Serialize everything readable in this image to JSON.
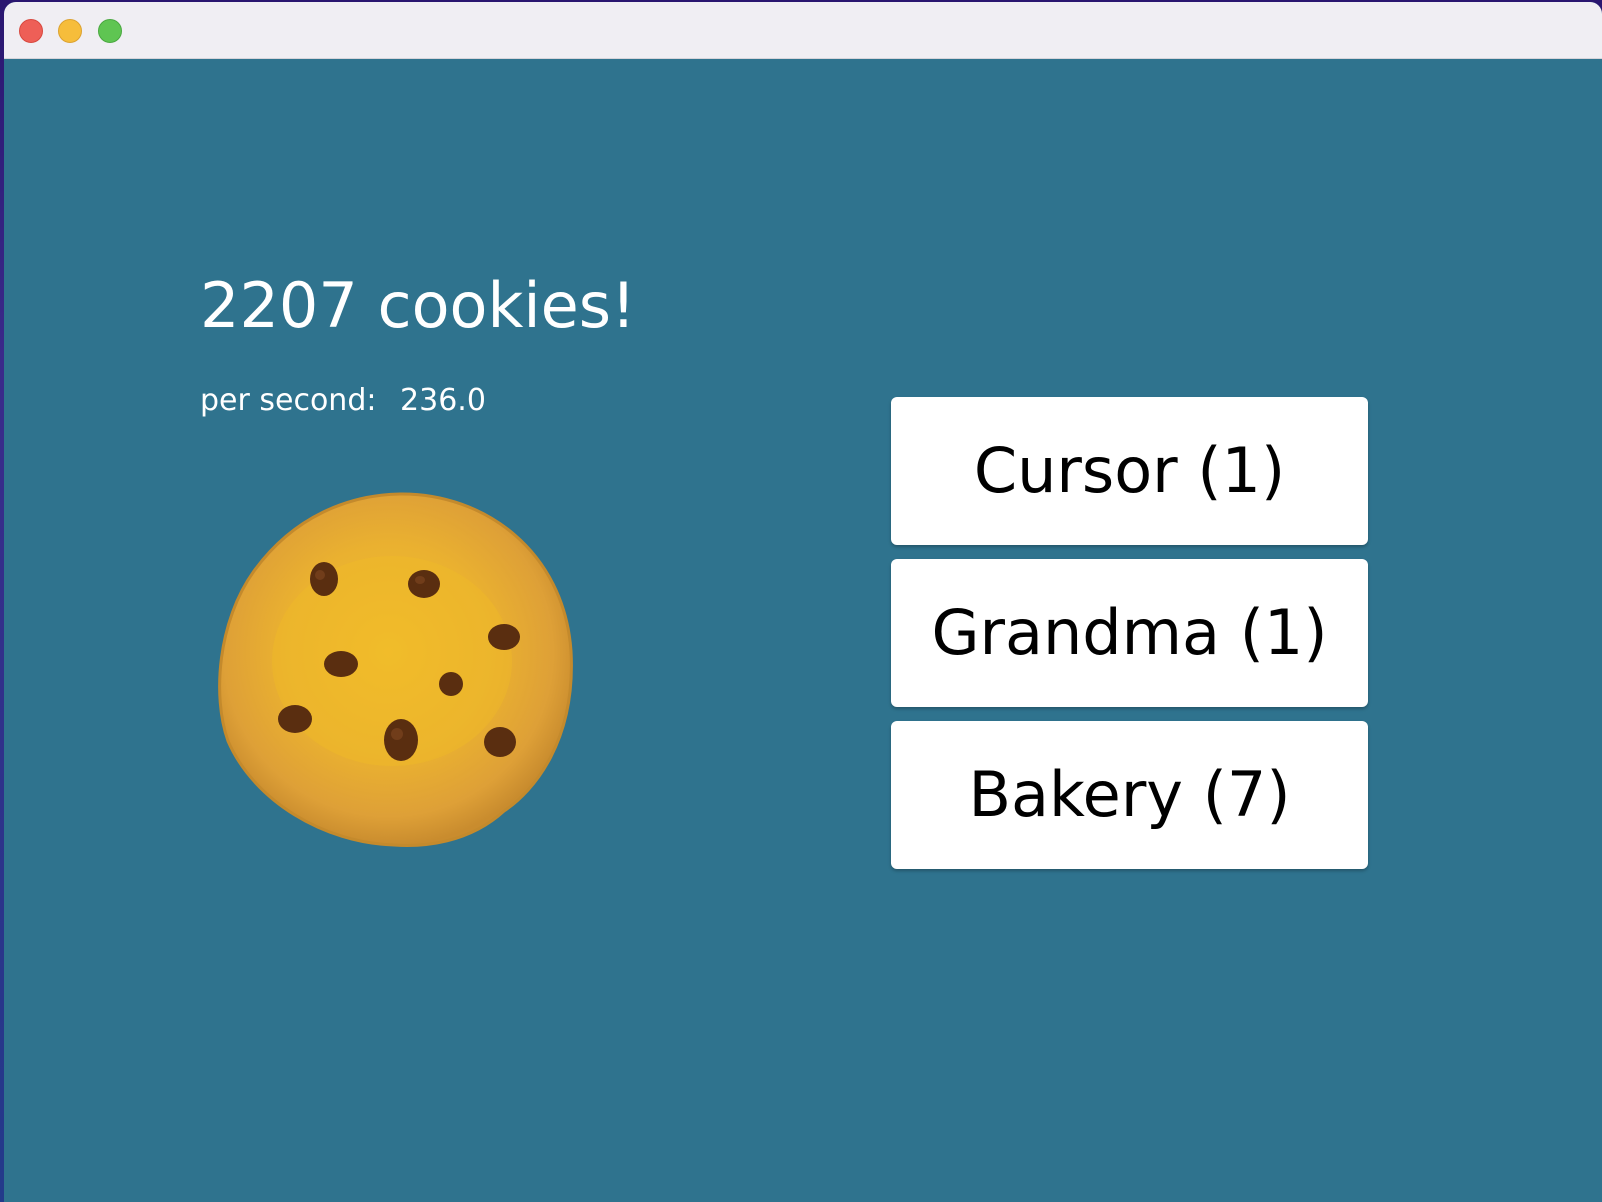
{
  "game": {
    "cookie_count": "2207 cookies!",
    "per_second_label": "per second:",
    "per_second_value": "236.0"
  },
  "shop": {
    "items": [
      {
        "label": "Cursor (1)"
      },
      {
        "label": "Grandma (1)"
      },
      {
        "label": "Bakery (7)"
      }
    ]
  },
  "colors": {
    "background": "#2f738e",
    "button_bg": "#ffffff",
    "cookie_dough": "#e8b032",
    "chocolate_chip": "#5a2e10"
  },
  "icons": {
    "cookie": "cookie-icon"
  }
}
